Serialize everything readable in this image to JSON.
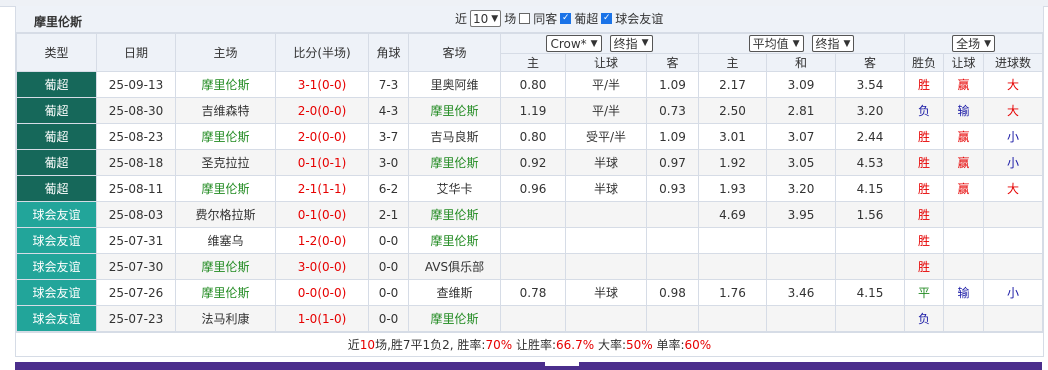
{
  "team_name": "摩里伦斯",
  "filters": {
    "recent_prefix": "近",
    "recent_count": "10",
    "recent_suffix": "场",
    "same_home_label": "同客",
    "same_home_checked": false,
    "league_label": "葡超",
    "league_checked": true,
    "friendly_label": "球会友谊",
    "friendly_checked": true
  },
  "headers": {
    "type": "类型",
    "date": "日期",
    "home": "主场",
    "score": "比分(半场)",
    "corners": "角球",
    "away": "客场",
    "company_select": "Crow*",
    "handicap_select": "终指",
    "avg_select": "平均值",
    "euro_select": "终指",
    "all_select": "全场",
    "sub": [
      "主",
      "让球",
      "客",
      "主",
      "和",
      "客",
      "胜负",
      "让球",
      "进球数"
    ]
  },
  "colors": {
    "league_primeira": "#16685a",
    "league_friendly": "#22a59a",
    "win": "#e60000",
    "lose": "#1a1aa6",
    "team_highlight": "#228b22"
  },
  "matches": [
    {
      "league": "葡超",
      "league_type": "primeira",
      "date": "25-09-13",
      "home": "摩里伦斯",
      "home_hl": true,
      "score_ft": "3-1",
      "score_ht": "(0-0)",
      "corners": "7-3",
      "away": "里奥阿维",
      "away_hl": false,
      "ah_home": "0.80",
      "ah_line": "平/半",
      "ah_away": "1.09",
      "eu_home": "2.17",
      "eu_draw": "3.09",
      "eu_away": "3.54",
      "result": "胜",
      "ah_result": "赢",
      "goals": "大"
    },
    {
      "league": "葡超",
      "league_type": "primeira",
      "date": "25-08-30",
      "home": "吉维森特",
      "home_hl": false,
      "score_ft": "2-0",
      "score_ht": "(0-0)",
      "corners": "4-3",
      "away": "摩里伦斯",
      "away_hl": true,
      "ah_home": "1.19",
      "ah_line": "平/半",
      "ah_away": "0.73",
      "eu_home": "2.50",
      "eu_draw": "2.81",
      "eu_away": "3.20",
      "result": "负",
      "ah_result": "输",
      "goals": "大"
    },
    {
      "league": "葡超",
      "league_type": "primeira",
      "date": "25-08-23",
      "home": "摩里伦斯",
      "home_hl": true,
      "score_ft": "2-0",
      "score_ht": "(0-0)",
      "corners": "3-7",
      "away": "吉马良斯",
      "away_hl": false,
      "ah_home": "0.80",
      "ah_line": "受平/半",
      "ah_away": "1.09",
      "eu_home": "3.01",
      "eu_draw": "3.07",
      "eu_away": "2.44",
      "result": "胜",
      "ah_result": "赢",
      "goals": "小"
    },
    {
      "league": "葡超",
      "league_type": "primeira",
      "date": "25-08-18",
      "home": "圣克拉拉",
      "home_hl": false,
      "score_ft": "0-1",
      "score_ht": "(0-1)",
      "corners": "3-0",
      "away": "摩里伦斯",
      "away_hl": true,
      "ah_home": "0.92",
      "ah_line": "半球",
      "ah_away": "0.97",
      "eu_home": "1.92",
      "eu_draw": "3.05",
      "eu_away": "4.53",
      "result": "胜",
      "ah_result": "赢",
      "goals": "小"
    },
    {
      "league": "葡超",
      "league_type": "primeira",
      "date": "25-08-11",
      "home": "摩里伦斯",
      "home_hl": true,
      "score_ft": "2-1",
      "score_ht": "(1-1)",
      "corners": "6-2",
      "away": "艾华卡",
      "away_hl": false,
      "ah_home": "0.96",
      "ah_line": "半球",
      "ah_away": "0.93",
      "eu_home": "1.93",
      "eu_draw": "3.20",
      "eu_away": "4.15",
      "result": "胜",
      "ah_result": "赢",
      "goals": "大"
    },
    {
      "league": "球会友谊",
      "league_type": "friendly",
      "date": "25-08-03",
      "home": "费尔格拉斯",
      "home_hl": false,
      "score_ft": "0-1",
      "score_ht": "(0-0)",
      "corners": "2-1",
      "away": "摩里伦斯",
      "away_hl": true,
      "ah_home": "",
      "ah_line": "",
      "ah_away": "",
      "eu_home": "4.69",
      "eu_draw": "3.95",
      "eu_away": "1.56",
      "result": "胜",
      "ah_result": "",
      "goals": ""
    },
    {
      "league": "球会友谊",
      "league_type": "friendly",
      "date": "25-07-31",
      "home": "维塞乌",
      "home_hl": false,
      "score_ft": "1-2",
      "score_ht": "(0-0)",
      "corners": "0-0",
      "away": "摩里伦斯",
      "away_hl": true,
      "ah_home": "",
      "ah_line": "",
      "ah_away": "",
      "eu_home": "",
      "eu_draw": "",
      "eu_away": "",
      "result": "胜",
      "ah_result": "",
      "goals": ""
    },
    {
      "league": "球会友谊",
      "league_type": "friendly",
      "date": "25-07-30",
      "home": "摩里伦斯",
      "home_hl": true,
      "score_ft": "3-0",
      "score_ht": "(0-0)",
      "corners": "0-0",
      "away": "AVS俱乐部",
      "away_hl": false,
      "ah_home": "",
      "ah_line": "",
      "ah_away": "",
      "eu_home": "",
      "eu_draw": "",
      "eu_away": "",
      "result": "胜",
      "ah_result": "",
      "goals": ""
    },
    {
      "league": "球会友谊",
      "league_type": "friendly",
      "date": "25-07-26",
      "home": "摩里伦斯",
      "home_hl": true,
      "score_ft": "0-0",
      "score_ht": "(0-0)",
      "corners": "0-0",
      "away": "查维斯",
      "away_hl": false,
      "ah_home": "0.78",
      "ah_line": "半球",
      "ah_away": "0.98",
      "eu_home": "1.76",
      "eu_draw": "3.46",
      "eu_away": "4.15",
      "result": "平",
      "ah_result": "输",
      "goals": "小"
    },
    {
      "league": "球会友谊",
      "league_type": "friendly",
      "date": "25-07-23",
      "home": "法马利康",
      "home_hl": false,
      "score_ft": "1-0",
      "score_ht": "(1-0)",
      "corners": "0-0",
      "away": "摩里伦斯",
      "away_hl": true,
      "ah_home": "",
      "ah_line": "",
      "ah_away": "",
      "eu_home": "",
      "eu_draw": "",
      "eu_away": "",
      "result": "负",
      "ah_result": "",
      "goals": ""
    }
  ],
  "summary": {
    "prefix": "近",
    "games": "10",
    "record": "场,胜7平1负2, 胜率:",
    "win_rate": "70%",
    "ah_label": " 让胜率:",
    "ah_rate": "66.7%",
    "over_label": " 大率:",
    "over_rate": "50%",
    "odd_label": " 单率:",
    "odd_rate": "60%"
  }
}
